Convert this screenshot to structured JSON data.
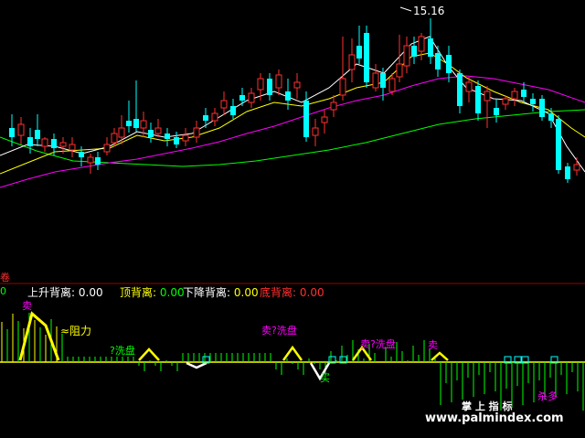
{
  "price_panel": {
    "high_label": "15.16",
    "colors": {
      "up": "#ff3030",
      "down": "#00ffff",
      "ma5": "#ffffff",
      "ma10": "#ffff00",
      "ma20": "#ff00ff",
      "ma60": "#00ff00"
    }
  },
  "indicator_panel": {
    "left_marker": "卷",
    "zero_marker": "0",
    "header": [
      {
        "label": "上升背离:",
        "value": "0.00",
        "color": "#ffffff"
      },
      {
        "label": "顶背离:",
        "value": "0.00",
        "color": "#ffff00"
      },
      {
        "label": "下降背离:",
        "value": "0.00",
        "color": "#ffffff"
      },
      {
        "label": "底背离:",
        "value": "0.00",
        "color": "#ff3030"
      }
    ],
    "annotations": [
      {
        "text": "卖",
        "color": "#ff00ff"
      },
      {
        "text": "≈阻力",
        "color": "#ffff00"
      },
      {
        "text": "?洗盘",
        "color": "#00ff00"
      },
      {
        "text": "卖?洗盘",
        "color": "#ff00ff"
      },
      {
        "text": "买",
        "color": "#00ff00"
      },
      {
        "text": "卖?洗盘",
        "color": "#ff00ff"
      },
      {
        "text": "卖",
        "color": "#ff00ff"
      },
      {
        "text": "杀多",
        "color": "#ff00ff"
      }
    ]
  },
  "watermark": {
    "title": "掌 上 指 标",
    "url": "www.palmindex.com"
  }
}
